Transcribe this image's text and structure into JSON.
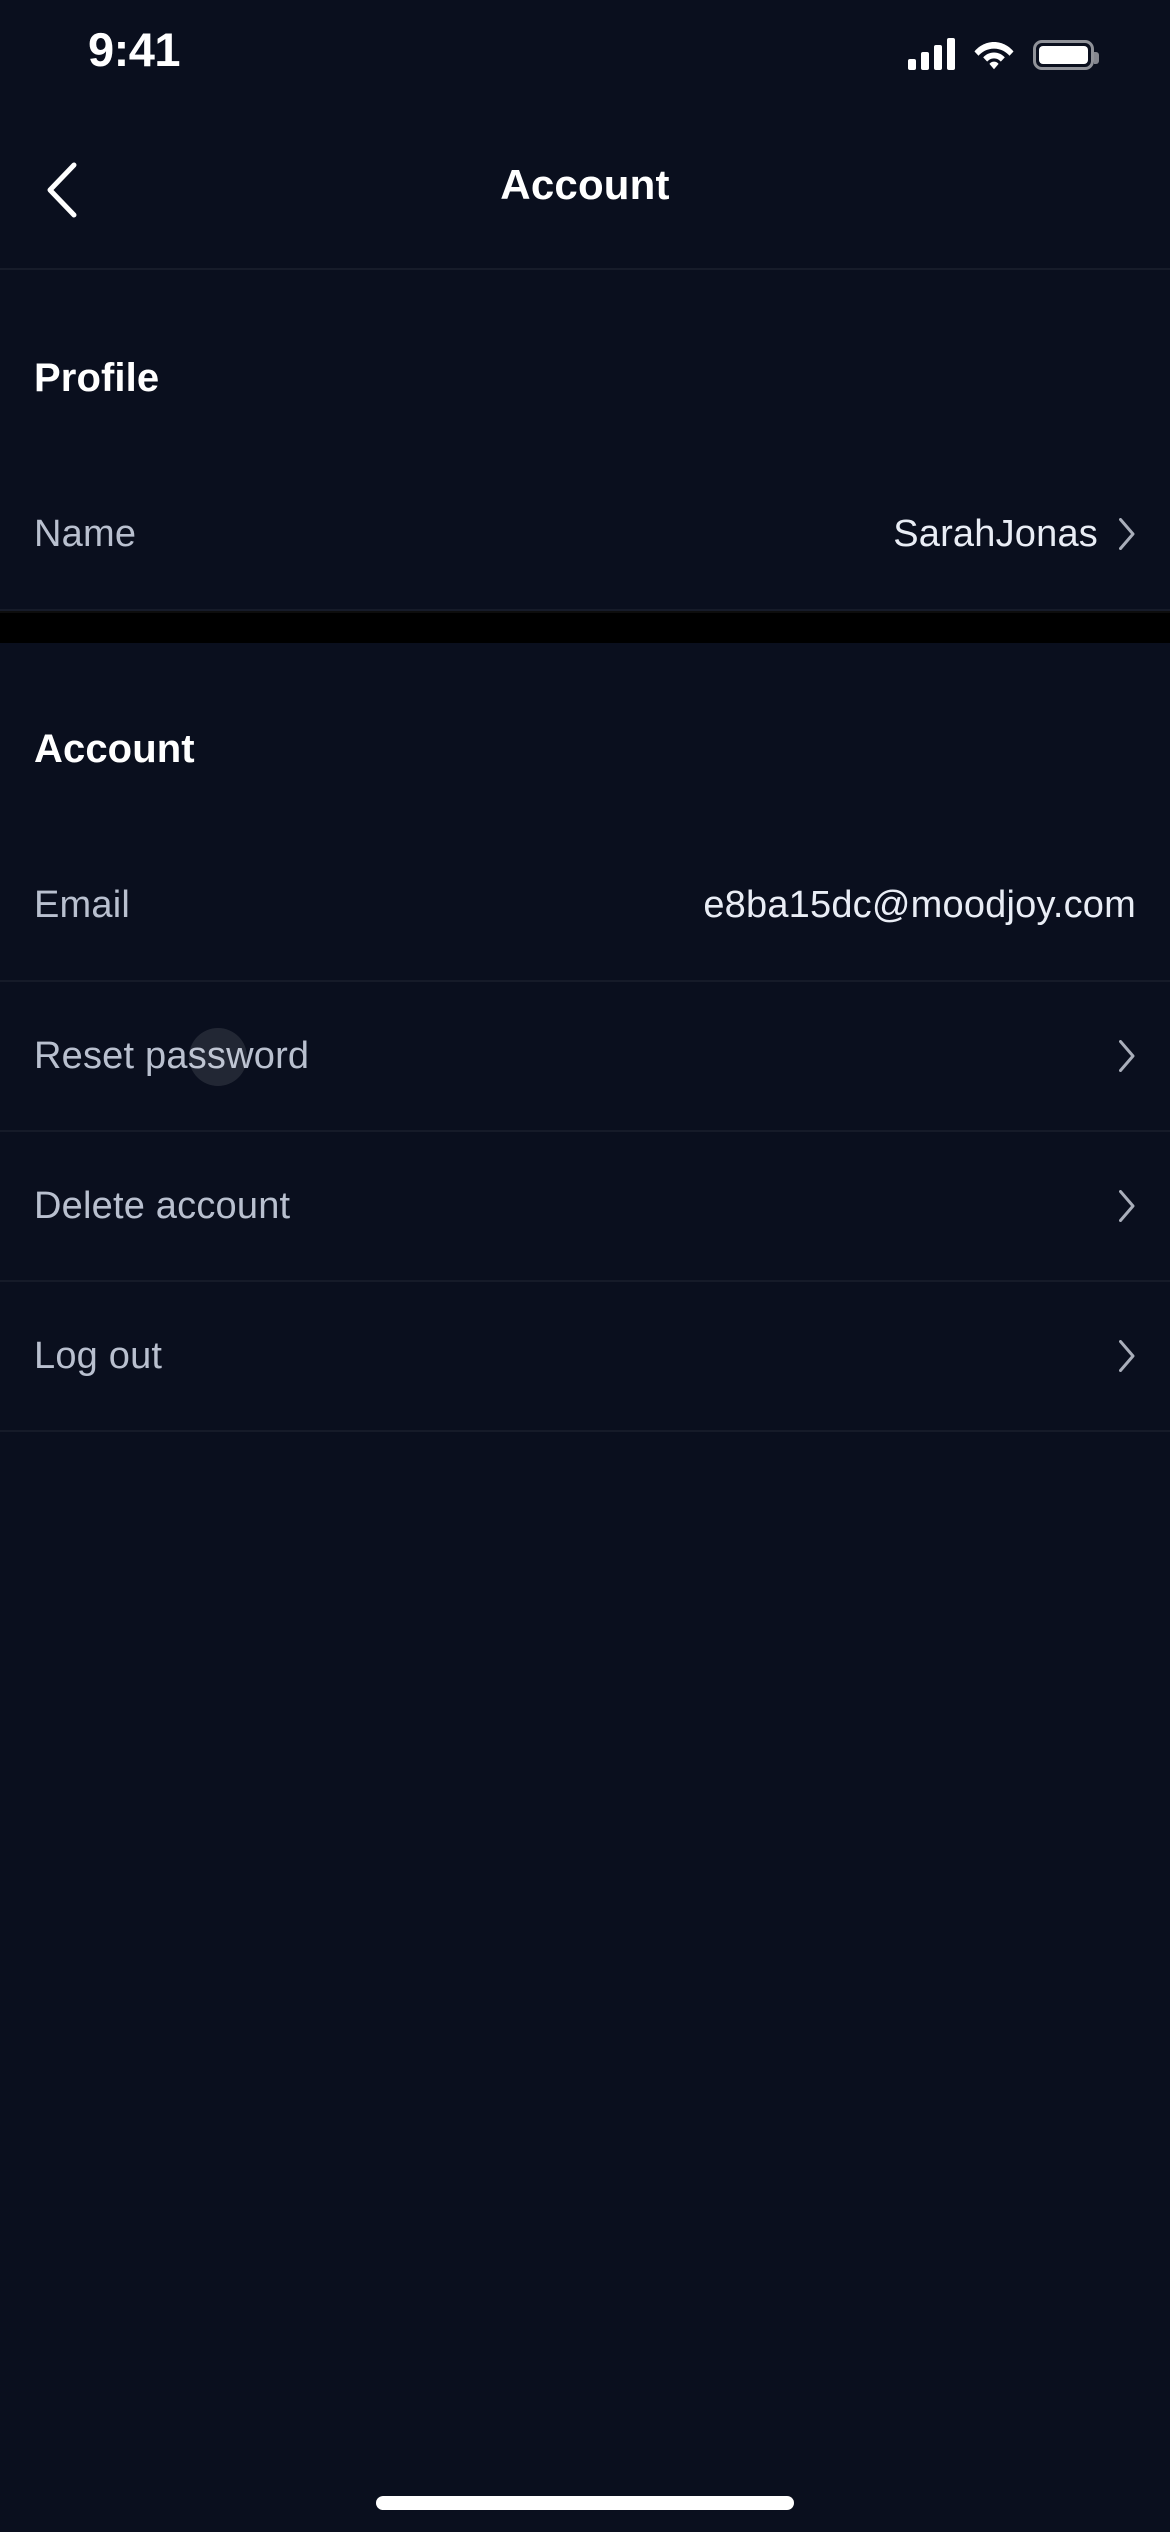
{
  "status_bar": {
    "time": "9:41",
    "cellular_icon": "signal-bars-icon",
    "wifi_icon": "wifi-icon",
    "battery_icon": "battery-full-icon"
  },
  "nav": {
    "back_icon": "chevron-left-icon",
    "title": "Account"
  },
  "sections": [
    {
      "heading": "Profile",
      "rows": [
        {
          "label": "Name",
          "value": "SarahJonas",
          "chevron": "chevron-right-icon"
        }
      ]
    },
    {
      "heading": "Account",
      "rows": [
        {
          "label": "Email",
          "value": "e8ba15dc@moodjoy.com",
          "chevron": ""
        },
        {
          "label": "Reset password",
          "value": "",
          "chevron": "chevron-right-icon"
        },
        {
          "label": "Delete account",
          "value": "",
          "chevron": "chevron-right-icon"
        },
        {
          "label": "Log out",
          "value": "",
          "chevron": "chevron-right-icon"
        }
      ]
    }
  ],
  "colors": {
    "background": "#0a0f1e",
    "separator_band": "#000000",
    "heading_text": "#ffffff",
    "label_text": "#b9c0cf",
    "value_text": "#e9edf5",
    "divider": "rgba(255,255,255,0.05)"
  },
  "home_indicator": "home-indicator"
}
